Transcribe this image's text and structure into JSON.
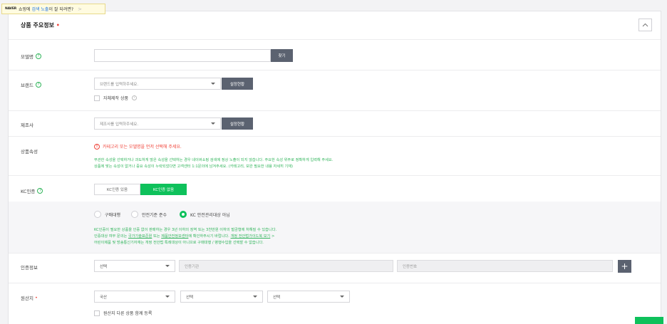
{
  "banner": {
    "brand": "NAVER",
    "text_prefix": "쇼핑에",
    "text_highlight": "검색 노출",
    "text_suffix": "이 잘 되려면?",
    "arrow": ">"
  },
  "section": {
    "title": "상품 주요정보",
    "required_mark": "•"
  },
  "model": {
    "label": "모델명",
    "input_value": "",
    "find_button": "찾기"
  },
  "brand": {
    "label": "브랜드",
    "placeholder": "브랜드를 입력하주세요.",
    "settings_button": "설정현황",
    "own_product_label": "자체제작 상품"
  },
  "manufacturer": {
    "label": "제조사",
    "placeholder": "제조사를 입력하주세요.",
    "settings_button": "설정현황"
  },
  "attributes": {
    "label": "상품속성",
    "warning": "카테고리 또는 모델명을 먼저 선택해 주세요.",
    "desc_line1": "무관한 속성을 선택하거나 과도하게 많은 속성을 선택하는 경우 네이버쇼핑 검색에 정상 노출이 되지 않습니다. 주요한 속성 위주로 정확하게 입력해 주세요.",
    "desc_line2": "상품에 맞는 속성이 없거나 중요 속성이 누락되었다면 고객센터 1:1문의에 남겨주세요. (카테고리, 보완 필요한 내용 자세히 기재)"
  },
  "kc": {
    "label": "KC인증",
    "option_yes": "KC인증 있음",
    "option_no": "KC인증 없음",
    "radio_options": [
      "구매대행",
      "안전기준 준수",
      "KC 안전관리대상 아님"
    ],
    "selected_index": 2,
    "note_line1": "KC인증이 필요한 상품을 인증 없이 판매하는 경우 3년 이하의 징역 또는 3천만원 이하의 벌금형에 처해질 수 있습니다.",
    "note_line2_a": "인증대상 여부 문의는",
    "note_line2_link1": "국가기술표준원",
    "note_line2_b": "또는",
    "note_line2_link2": "제품안전정보센터",
    "note_line2_c": "에 확인하주시기 바랍니다.",
    "note_line2_link3": "개정 전안법가이드북 보기",
    "note_line2_arrow": ">",
    "note_line3": "어린이제품 및 방송통신기자재는 개정 전안법 특례대상이 아니므로 구매대행 / 병행수입을 선택할 수 없습니다."
  },
  "cert": {
    "label": "인증정보",
    "select_value": "선택",
    "agency_placeholder": "인증기관",
    "number_placeholder": "인증번호",
    "add_button": "+"
  },
  "origin": {
    "label": "원산지",
    "required_mark": "•",
    "select1": "국산",
    "select2": "선택",
    "select3": "선택",
    "multi_label": "원산지 다른 상품 함께 등록"
  },
  "colors": {
    "green": "#0ec15b",
    "dark_button": "#5b6270",
    "required": "#f0443a"
  }
}
